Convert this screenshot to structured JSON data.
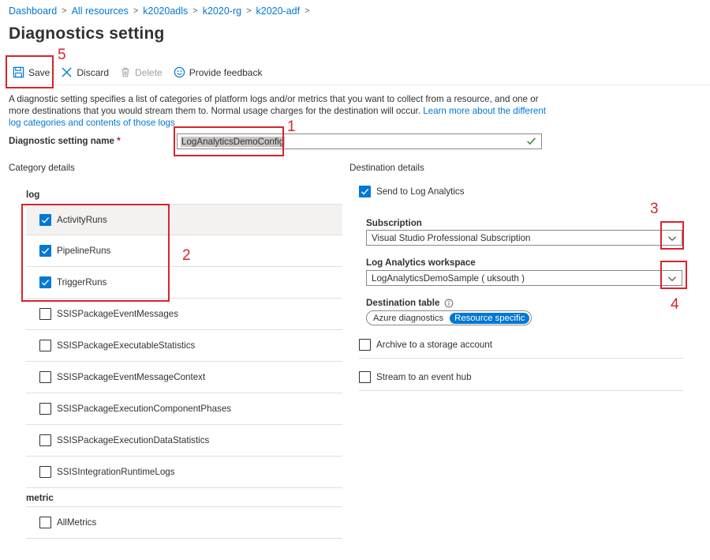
{
  "breadcrumb": [
    "Dashboard",
    "All resources",
    "k2020adls",
    "k2020-rg",
    "k2020-adf"
  ],
  "page_title": "Diagnostics setting",
  "toolbar": {
    "save": "Save",
    "discard": "Discard",
    "delete": "Delete",
    "feedback": "Provide feedback"
  },
  "description": {
    "text": "A diagnostic setting specifies a list of categories of platform logs and/or metrics that you want to collect from a resource, and one or more destinations that you would stream them to. Normal usage charges for the destination will occur.",
    "link": "Learn more about the different log categories and contents of those logs"
  },
  "setting_name": {
    "label": "Diagnostic setting name",
    "required": "*",
    "value": "LogAnalyticsDemoConfig"
  },
  "category_details": {
    "heading": "Category details",
    "log_label": "log",
    "logs": [
      {
        "name": "ActivityRuns",
        "checked": true
      },
      {
        "name": "PipelineRuns",
        "checked": true
      },
      {
        "name": "TriggerRuns",
        "checked": true
      },
      {
        "name": "SSISPackageEventMessages",
        "checked": false
      },
      {
        "name": "SSISPackageExecutableStatistics",
        "checked": false
      },
      {
        "name": "SSISPackageEventMessageContext",
        "checked": false
      },
      {
        "name": "SSISPackageExecutionComponentPhases",
        "checked": false
      },
      {
        "name": "SSISPackageExecutionDataStatistics",
        "checked": false
      },
      {
        "name": "SSISIntegrationRuntimeLogs",
        "checked": false
      }
    ],
    "metric_label": "metric",
    "metrics": [
      {
        "name": "AllMetrics",
        "checked": false
      }
    ]
  },
  "destination_details": {
    "heading": "Destination details",
    "send_to_log_analytics": {
      "label": "Send to Log Analytics",
      "checked": true
    },
    "subscription": {
      "label": "Subscription",
      "value": "Visual Studio Professional Subscription"
    },
    "workspace": {
      "label": "Log Analytics workspace",
      "value": "LogAnalyticsDemoSample ( uksouth )"
    },
    "destination_table": {
      "label": "Destination table",
      "options": [
        "Azure diagnostics",
        "Resource specific"
      ],
      "selected": "Resource specific"
    },
    "archive": {
      "label": "Archive to a storage account",
      "checked": false
    },
    "event_hub": {
      "label": "Stream to an event hub",
      "checked": false
    }
  },
  "annotations": [
    "1",
    "2",
    "3",
    "4",
    "5"
  ],
  "colors": {
    "accent": "#0078d4",
    "annotation": "#d9232e"
  }
}
